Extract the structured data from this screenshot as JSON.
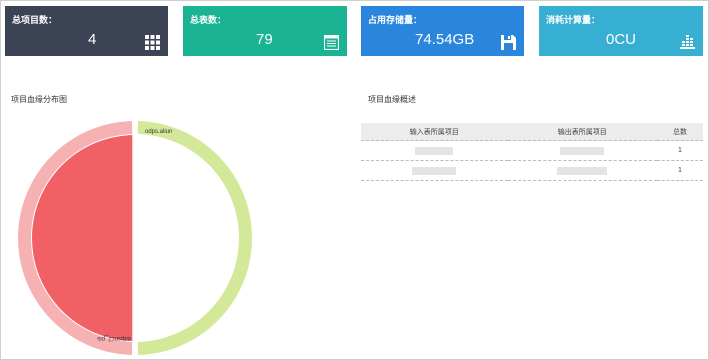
{
  "stats": [
    {
      "label": "总项目数：",
      "value": "4",
      "icon": "grid-icon",
      "color": "#3b4355"
    },
    {
      "label": "总表数：",
      "value": "79",
      "icon": "table-list-icon",
      "color": "#1ab394"
    },
    {
      "label": "占用存储量：",
      "value": "74.54GB",
      "icon": "save-disk-icon",
      "color": "#2a86dd"
    },
    {
      "label": "消耗计算量：",
      "value": "0CU",
      "icon": "bar-stack-icon",
      "color": "#36afd3"
    }
  ],
  "chart_section": {
    "title": "项目血缘分布图"
  },
  "chart_data": {
    "type": "pie",
    "labels": [
      "odps.aliun",
      "odpsnc2_pis"
    ],
    "values": [
      50,
      50
    ],
    "colors": [
      "#d4e89a",
      "#f06064"
    ]
  },
  "table_section": {
    "title": "项目血缘概述",
    "columns": [
      "输入表所属项目",
      "输出表所属项目",
      "总数"
    ],
    "rows": [
      {
        "input": "",
        "output": "",
        "count": "1"
      },
      {
        "input": "",
        "output": "",
        "count": "1"
      }
    ]
  }
}
